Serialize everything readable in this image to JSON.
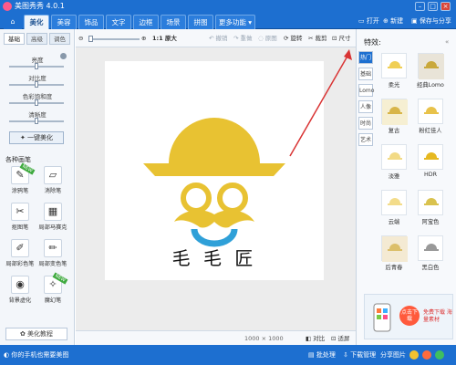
{
  "title": "美图秀秀 4.0.1",
  "nav": {
    "tabs": [
      "美化",
      "美容",
      "饰品",
      "文字",
      "边框",
      "场景",
      "拼图",
      "更多功能 ▾"
    ],
    "open": "打开",
    "new": "新建",
    "save": "保存与分享"
  },
  "left": {
    "subtabs": [
      "基础",
      "高级",
      "调色"
    ],
    "sliders": [
      "亮度",
      "对比度",
      "色彩饱和度",
      "清晰度"
    ],
    "one_key": "一键美化",
    "section": "各种画笔",
    "tools": [
      "涂鸦笔",
      "消除笔",
      "抠图笔",
      "局部马赛克",
      "局部彩色笔",
      "局部变色笔",
      "背景虚化",
      "魔幻笔"
    ],
    "new_badge": "NEW",
    "tutorial": "美化教程"
  },
  "toolbar": {
    "ratio": "1:1 原大",
    "undo": "撤销",
    "redo": "重做",
    "original": "原图",
    "rotate": "旋转",
    "crop": "裁剪",
    "size": "尺寸"
  },
  "canvas": {
    "logo_text": "毛 毛 匠",
    "brand_color": "#e8c232",
    "mouth_color": "#2fa0d8"
  },
  "footer": {
    "dims": "1000 × 1000",
    "compare": "对比",
    "fit": "适屏"
  },
  "right": {
    "title": "特效:",
    "categories": [
      "热门",
      "基础",
      "Lomo",
      "人像",
      "时尚",
      "艺术"
    ],
    "effects": [
      "柔光",
      "经典Lomo",
      "复古",
      "粉红佳人",
      "淡雅",
      "HDR",
      "云端",
      "阿宝色",
      "后青春",
      "黑白色"
    ],
    "ad_button": "点击下载",
    "ad_text": "免费下载 海量素材"
  },
  "status": {
    "tip": "你的手机也需要美图",
    "batch": "批处理",
    "download": "下载管理",
    "share": "分享图片"
  }
}
